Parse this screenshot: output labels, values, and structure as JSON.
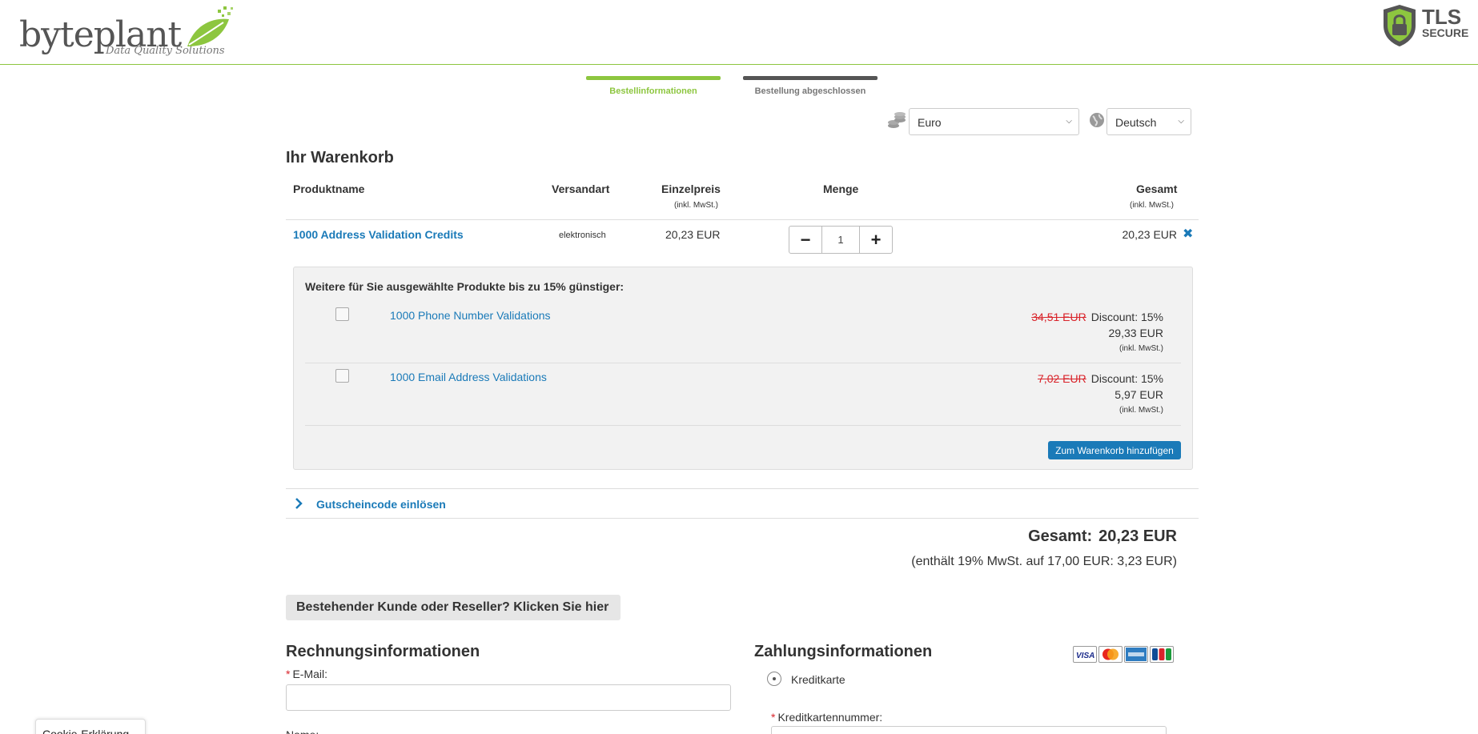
{
  "header": {
    "logo_word": "byteplant",
    "logo_tagline": "Data Quality Solutions",
    "tls_big": "TLS",
    "tls_small": "SECURE"
  },
  "steps": [
    {
      "label": "Bestellinformationen",
      "active": true
    },
    {
      "label": "Bestellung abgeschlossen",
      "active": false
    }
  ],
  "selectors": {
    "currency": "Euro",
    "language": "Deutsch"
  },
  "cart": {
    "title": "Ihr Warenkorb",
    "columns": {
      "product": "Produktname",
      "shipping": "Versandart",
      "unit_price": "Einzelpreis",
      "unit_price_note": "(inkl. MwSt.)",
      "quantity": "Menge",
      "total": "Gesamt",
      "total_note": "(inkl. MwSt.)"
    },
    "items": [
      {
        "name": "1000 Address Validation Credits",
        "shipping": "elektronisch",
        "unit_price": "20,23 EUR",
        "quantity": "1",
        "total": "20,23 EUR"
      }
    ]
  },
  "upsell": {
    "title": "Weitere für Sie ausgewählte Produkte bis zu 15% günstiger:",
    "items": [
      {
        "name": "1000 Phone Number Validations",
        "old_price": "34,51 EUR",
        "discount": "Discount: 15%",
        "new_price": "29,33 EUR",
        "vat_note": "(inkl. MwSt.)"
      },
      {
        "name": "1000 Email Address Validations",
        "old_price": "7,02 EUR",
        "discount": "Discount: 15%",
        "new_price": "5,97 EUR",
        "vat_note": "(inkl. MwSt.)"
      }
    ],
    "add_button": "Zum Warenkorb hinzufügen"
  },
  "coupon": {
    "label": "Gutscheincode einlösen"
  },
  "summary": {
    "total_label": "Gesamt:",
    "total_value": "20,23 EUR",
    "vat_note": "(enthält 19% MwSt. auf 17,00 EUR: 3,23 EUR)"
  },
  "reseller_button": "Bestehender Kunde oder Reseller? Klicken Sie hier",
  "billing": {
    "title": "Rechnungsinformationen",
    "email_label": "E-Mail:",
    "next_label": "Name:"
  },
  "payment": {
    "title": "Zahlungsinformationen",
    "method": "Kreditkarte",
    "card_number_label": "Kreditkartennummer:",
    "cards": [
      "visa-card-icon",
      "mastercard-icon",
      "amex-card-icon",
      "jcb-card-icon"
    ]
  },
  "cookie_label": "Cookie-Erklärung",
  "colors": {
    "brand_green": "#8dc63f",
    "link_blue": "#1a7ab8",
    "strike_red": "#d9232a"
  }
}
